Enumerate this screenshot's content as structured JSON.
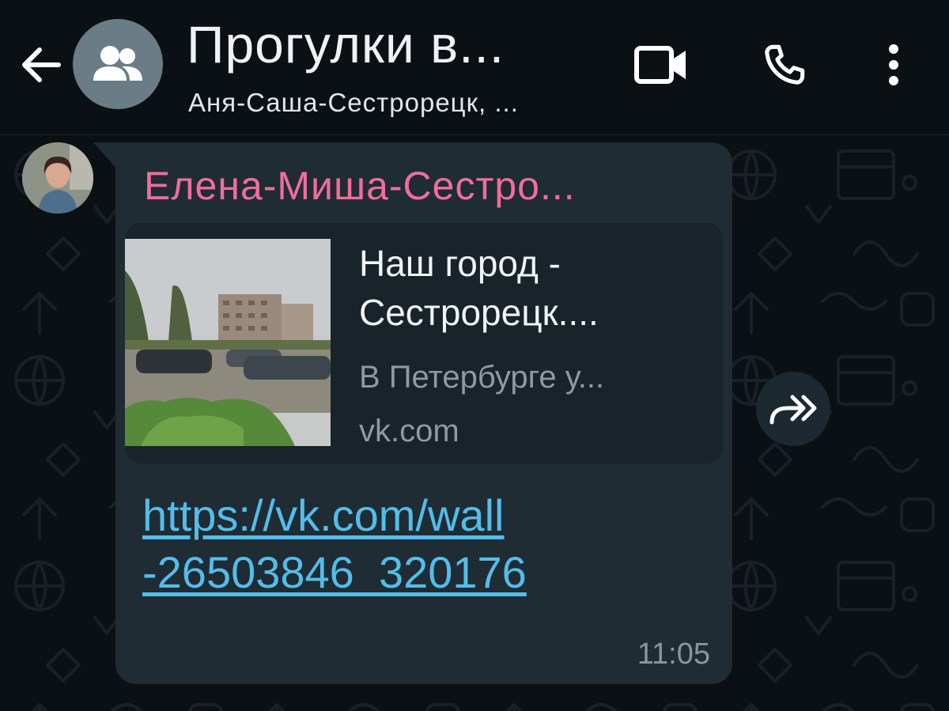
{
  "header": {
    "title": "Прогулки в...",
    "subtitle": "Аня-Саша-Сестрорецк, ...",
    "icons": {
      "back": "arrow-left-icon",
      "avatar": "group-icon",
      "video": "video-camera-icon",
      "call": "phone-icon",
      "menu": "vertical-dots-icon"
    }
  },
  "message": {
    "sender": "Елена-Миша-Сестро...",
    "sender_color": "#f16d9a",
    "preview": {
      "title_line1": "Наш город -",
      "title_line2": "Сестрорецк....",
      "description": "В Петербурге у...",
      "domain": "vk.com"
    },
    "link_line1": "https://vk.com/wall",
    "link_line2": "-26503846_320176",
    "link_color": "#53bdeb",
    "time": "11:05",
    "forward_icon": "forward-icon"
  },
  "colors": {
    "background": "#0b1014",
    "bubble": "#1f2c33",
    "preview_card": "#18232a"
  }
}
